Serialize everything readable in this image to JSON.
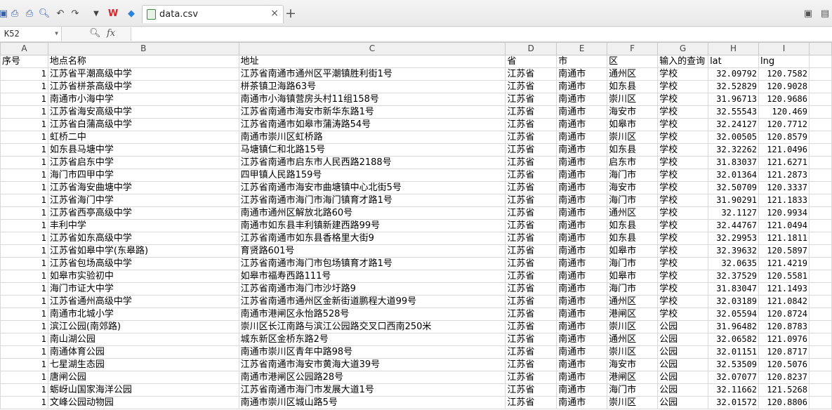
{
  "toolbar": {
    "tab_title": "data.csv",
    "close_glyph": "×",
    "add_glyph": "+"
  },
  "formula_bar": {
    "cell_ref": "K52",
    "fx_label": "fx",
    "formula": ""
  },
  "columns": [
    "A",
    "B",
    "C",
    "D",
    "E",
    "F",
    "G",
    "H",
    "I"
  ],
  "header_row": [
    "序号",
    "地点名称",
    "地址",
    "省",
    "市",
    "区",
    "输入的查询",
    "lat",
    "lng"
  ],
  "rows": [
    [
      "1",
      "江苏省平潮高级中学",
      "江苏省南通市通州区平潮镇胜利街1号",
      "江苏省",
      "南通市",
      "通州区",
      "学校",
      "32.09792",
      "120.7582"
    ],
    [
      "1",
      "江苏省栟茶高级中学",
      "栟茶镇卫海路63号",
      "江苏省",
      "南通市",
      "如东县",
      "学校",
      "32.52829",
      "120.9028"
    ],
    [
      "1",
      "南通市小海中学",
      "南通市小海镇营房头村11组158号",
      "江苏省",
      "南通市",
      "崇川区",
      "学校",
      "31.96713",
      "120.9686"
    ],
    [
      "1",
      "江苏省海安高级中学",
      "江苏省南通市海安市新华东路1号",
      "江苏省",
      "南通市",
      "海安市",
      "学校",
      "32.55543",
      "120.469"
    ],
    [
      "1",
      "江苏省白蒲高级中学",
      "江苏省南通市如皋市蒲涛路54号",
      "江苏省",
      "南通市",
      "如皋市",
      "学校",
      "32.24127",
      "120.7712"
    ],
    [
      "1",
      "虹桥二中",
      "南通市崇川区虹桥路",
      "江苏省",
      "南通市",
      "崇川区",
      "学校",
      "32.00505",
      "120.8579"
    ],
    [
      "1",
      "如东县马塘中学",
      "马塘镇仁和北路15号",
      "江苏省",
      "南通市",
      "如东县",
      "学校",
      "32.32262",
      "121.0496"
    ],
    [
      "1",
      "江苏省启东中学",
      "江苏省南通市启东市人民西路2188号",
      "江苏省",
      "南通市",
      "启东市",
      "学校",
      "31.83037",
      "121.6271"
    ],
    [
      "1",
      "海门市四甲中学",
      "四甲镇人民路159号",
      "江苏省",
      "南通市",
      "海门市",
      "学校",
      "32.01364",
      "121.2873"
    ],
    [
      "1",
      "江苏省海安曲塘中学",
      "江苏省南通市海安市曲塘镇中心北街5号",
      "江苏省",
      "南通市",
      "海安市",
      "学校",
      "32.50709",
      "120.3337"
    ],
    [
      "1",
      "江苏省海门中学",
      "江苏省南通市海门市海门镇育才路1号",
      "江苏省",
      "南通市",
      "海门市",
      "学校",
      "31.90291",
      "121.1833"
    ],
    [
      "1",
      "江苏省西亭高级中学",
      "南通市通州区解放北路60号",
      "江苏省",
      "南通市",
      "通州区",
      "学校",
      "32.1127",
      "120.9934"
    ],
    [
      "1",
      "丰利中学",
      "南通市如东县丰利镇新建西路99号",
      "江苏省",
      "南通市",
      "如东县",
      "学校",
      "32.44767",
      "121.0494"
    ],
    [
      "1",
      "江苏省如东高级中学",
      "江苏省南通市如东县香格里大街9",
      "江苏省",
      "南通市",
      "如东县",
      "学校",
      "32.29953",
      "121.1811"
    ],
    [
      "1",
      "江苏省如皋中学(东皋路)",
      "育贤路601号",
      "江苏省",
      "南通市",
      "如皋市",
      "学校",
      "32.39632",
      "120.5897"
    ],
    [
      "1",
      "江苏省包场高级中学",
      "江苏省南通市海门市包场镇育才路1号",
      "江苏省",
      "南通市",
      "海门市",
      "学校",
      "32.0635",
      "121.4219"
    ],
    [
      "1",
      "如皋市实验初中",
      "如皋市福寿西路111号",
      "江苏省",
      "南通市",
      "如皋市",
      "学校",
      "32.37529",
      "120.5581"
    ],
    [
      "1",
      "海门市证大中学",
      "江苏省南通市海门市沙圩路9",
      "江苏省",
      "南通市",
      "海门市",
      "学校",
      "31.83047",
      "121.1493"
    ],
    [
      "1",
      "江苏省通州高级中学",
      "江苏省南通市通州区金新街道鹏程大道99号",
      "江苏省",
      "南通市",
      "通州区",
      "学校",
      "32.03189",
      "121.0842"
    ],
    [
      "1",
      "南通市北城小学",
      "南通市港闸区永怡路528号",
      "江苏省",
      "南通市",
      "港闸区",
      "学校",
      "32.05594",
      "120.8724"
    ],
    [
      "1",
      "滨江公园(南郊路)",
      "崇川区长江南路与滨江公园路交叉口西南250米",
      "江苏省",
      "南通市",
      "崇川区",
      "公园",
      "31.96482",
      "120.8783"
    ],
    [
      "1",
      "南山湖公园",
      "城东新区金桥东路2号",
      "江苏省",
      "南通市",
      "通州区",
      "公园",
      "32.06582",
      "121.0976"
    ],
    [
      "1",
      "南通体育公园",
      "南通市崇川区青年中路98号",
      "江苏省",
      "南通市",
      "崇川区",
      "公园",
      "32.01151",
      "120.8717"
    ],
    [
      "1",
      "七星湖生态园",
      "江苏省南通市海安市黄海大道39号",
      "江苏省",
      "南通市",
      "海安市",
      "公园",
      "32.53509",
      "120.5076"
    ],
    [
      "1",
      "唐闸公园",
      "南通市港闸区公园路28号",
      "江苏省",
      "南通市",
      "港闸区",
      "公园",
      "32.07077",
      "120.8237"
    ],
    [
      "1",
      "蛎岈山国家海洋公园",
      "江苏省南通市海门市发展大道1号",
      "江苏省",
      "南通市",
      "海门市",
      "公园",
      "32.11662",
      "121.5268"
    ],
    [
      "1",
      "文峰公园动物园",
      "南通市崇川区城山路5号",
      "江苏省",
      "南通市",
      "崇川区",
      "公园",
      "32.01572",
      "120.8806"
    ]
  ]
}
